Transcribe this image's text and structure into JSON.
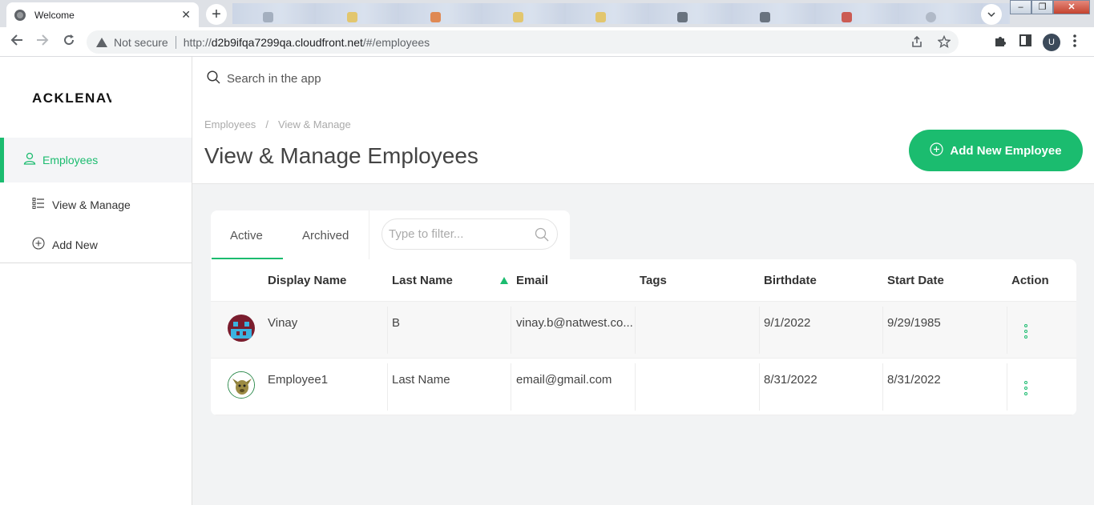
{
  "browser": {
    "tab_title": "Welcome",
    "tab_close": "✕",
    "new_tab": "+",
    "not_secure": "Not secure",
    "url_scheme": "http://",
    "url_host": "d2b9ifqa7299qa.cloudfront.net",
    "url_path": "/#/employees",
    "profile_initial": "U"
  },
  "app": {
    "logo": "ACKLENAVENUE",
    "search_placeholder": "Search in the app"
  },
  "sidebar": {
    "items": [
      {
        "label": "Employees",
        "icon": "person-icon"
      },
      {
        "label": "View & Manage",
        "icon": "list-icon"
      },
      {
        "label": "Add New",
        "icon": "plus-circle-icon"
      }
    ]
  },
  "header": {
    "breadcrumb": [
      "Employees",
      "View & Manage"
    ],
    "breadcrumb_sep": "/",
    "title": "View & Manage Employees",
    "add_button": "Add New Employee"
  },
  "tabs": {
    "items": [
      "Active",
      "Archived"
    ],
    "active": "Active",
    "filter_placeholder": "Type to filter..."
  },
  "table": {
    "columns": [
      "Display Name",
      "Last Name",
      "Email",
      "Tags",
      "Birthdate",
      "Start Date",
      "Action"
    ],
    "sort_column": "Email",
    "accent_color": "#1bbc6f",
    "rows": [
      {
        "display_name": "Vinay",
        "last_name": "B",
        "email": "vinay.b@natwest.co...",
        "tags": "",
        "birthdate": "9/1/2022",
        "start_date": "9/29/1985"
      },
      {
        "display_name": "Employee1",
        "last_name": "Last Name",
        "email": "email@gmail.com",
        "tags": "",
        "birthdate": "8/31/2022",
        "start_date": "8/31/2022"
      }
    ]
  }
}
